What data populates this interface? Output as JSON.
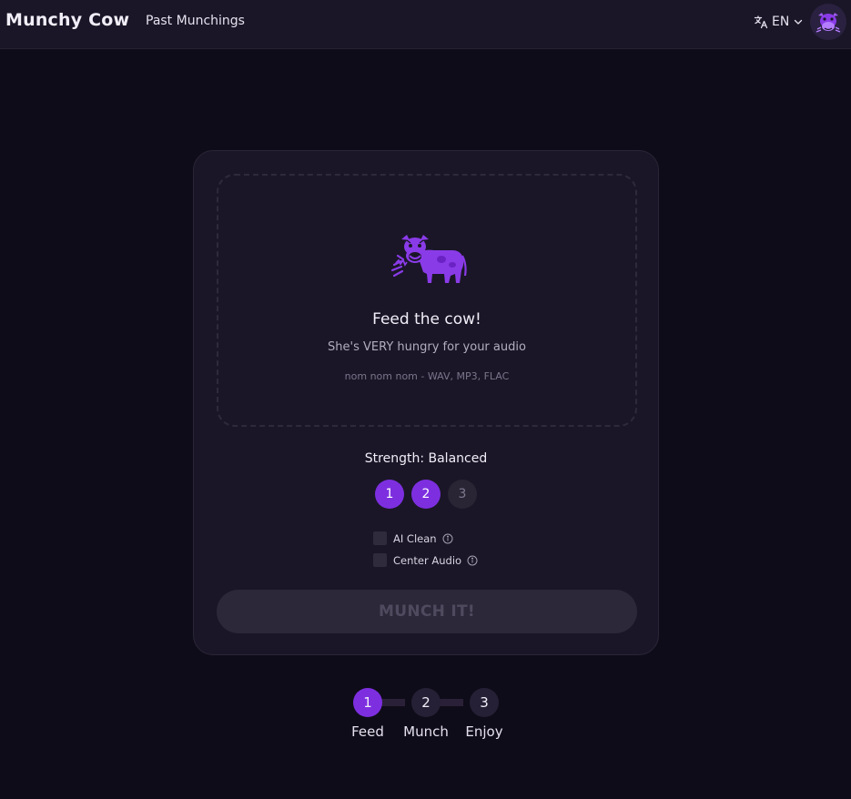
{
  "header": {
    "brand": "Munchy Cow",
    "nav_link": "Past Munchings",
    "language": "EN",
    "icons": {
      "translate": "translate-icon",
      "chevron": "chevron-down-icon",
      "avatar": "cow-avatar"
    }
  },
  "dropzone": {
    "title": "Feed the cow!",
    "subtitle": "She's VERY hungry for your audio",
    "formats": "nom nom nom - WAV, MP3, FLAC",
    "icon": "munching-cow-icon"
  },
  "strength": {
    "label": "Strength: Balanced",
    "levels": [
      "1",
      "2",
      "3"
    ],
    "selected_count": 2
  },
  "options": {
    "ai_clean": {
      "label": "AI Clean",
      "checked": false
    },
    "center_audio": {
      "label": "Center Audio",
      "checked": false
    }
  },
  "munch_button": {
    "label": "MUNCH IT!",
    "enabled": false
  },
  "steps": [
    {
      "number": "1",
      "label": "Feed",
      "active": true
    },
    {
      "number": "2",
      "label": "Munch",
      "active": false
    },
    {
      "number": "3",
      "label": "Enjoy",
      "active": false
    }
  ],
  "colors": {
    "accent": "#7d2fe0",
    "background": "#0f0c19",
    "surface": "#1a1627"
  }
}
